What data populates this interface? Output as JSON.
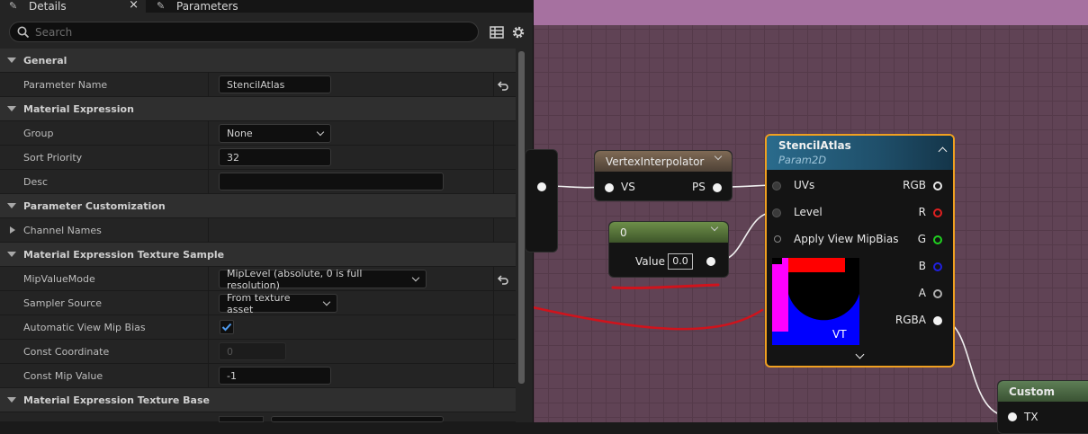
{
  "tabs": [
    {
      "label": "Details",
      "active": true
    },
    {
      "label": "Parameters",
      "active": false
    }
  ],
  "tab_close": "×",
  "search": {
    "placeholder": "Search",
    "value": ""
  },
  "rows": [
    {
      "type": "section",
      "label": "General"
    },
    {
      "type": "prop",
      "label": "Parameter Name",
      "control": "text",
      "value": "StencilAtlas",
      "reset": true
    },
    {
      "type": "section",
      "label": "Material Expression"
    },
    {
      "type": "prop",
      "label": "Group",
      "control": "combo",
      "value": "None"
    },
    {
      "type": "prop",
      "label": "Sort Priority",
      "control": "text",
      "value": "32"
    },
    {
      "type": "prop",
      "label": "Desc",
      "control": "text",
      "value": ""
    },
    {
      "type": "section",
      "label": "Parameter Customization"
    },
    {
      "type": "prop",
      "label": "Channel Names",
      "control": "none",
      "collapsed": true
    },
    {
      "type": "section",
      "label": "Material Expression Texture Sample"
    },
    {
      "type": "prop",
      "label": "MipValueMode",
      "control": "combo",
      "value": "MipLevel (absolute, 0 is full resolution)",
      "reset": true
    },
    {
      "type": "prop",
      "label": "Sampler Source",
      "control": "combo",
      "value": "From texture asset"
    },
    {
      "type": "prop",
      "label": "Automatic View Mip Bias",
      "control": "checkbox",
      "checked": true
    },
    {
      "type": "prop",
      "label": "Const Coordinate",
      "control": "text",
      "value": "0",
      "disabled": true
    },
    {
      "type": "prop",
      "label": "Const Mip Value",
      "control": "text",
      "value": "-1"
    },
    {
      "type": "section",
      "label": "Material Expression Texture Base"
    }
  ],
  "graph": {
    "vertex_interpolator": {
      "title": "VertexInterpolator",
      "in_pin": "VS",
      "out_pin": "PS"
    },
    "constant": {
      "title": "0",
      "value_label": "Value",
      "value": "0.0"
    },
    "stencil_atlas": {
      "title": "StencilAtlas",
      "subtitle": "Param2D",
      "inputs": [
        "UVs",
        "Level",
        "Apply View MipBias"
      ],
      "outputs": [
        {
          "label": "RGB",
          "color": "#e8e8e8"
        },
        {
          "label": "R",
          "color": "#e02020"
        },
        {
          "label": "G",
          "color": "#20d020"
        },
        {
          "label": "B",
          "color": "#2020e0"
        },
        {
          "label": "A",
          "color": "#b0b0b0"
        },
        {
          "label": "RGBA",
          "color": "#f2f2f2"
        }
      ],
      "preview_label": "VT"
    },
    "custom": {
      "title": "Custom",
      "pin": "TX"
    }
  },
  "annotation_color": "#d0131c"
}
